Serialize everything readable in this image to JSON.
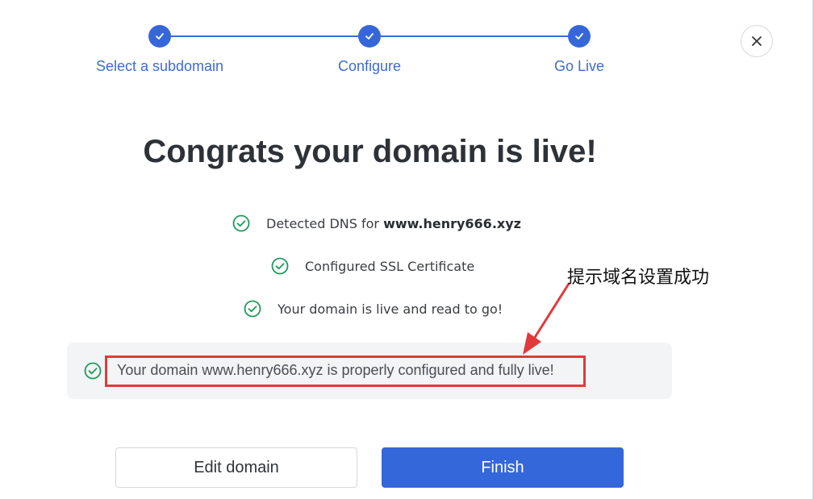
{
  "stepper": {
    "steps": [
      {
        "label": "Select a subdomain",
        "state": "complete"
      },
      {
        "label": "Configure",
        "state": "complete"
      },
      {
        "label": "Go Live",
        "state": "complete"
      }
    ],
    "icon": "check-icon"
  },
  "close": {
    "icon": "close-icon"
  },
  "title": "Congrats your domain is live!",
  "checks": {
    "dns_prefix": "Detected DNS for ",
    "dns_domain": "www.henry666.xyz",
    "ssl": "Configured SSL Certificate",
    "live": "Your domain is live and read to go!"
  },
  "banner": {
    "text": "Your domain www.henry666.xyz is properly configured and fully live!"
  },
  "annotation": {
    "text": "提示域名设置成功",
    "color": "#e23a3a"
  },
  "buttons": {
    "edit": "Edit domain",
    "finish": "Finish"
  },
  "colors": {
    "primary": "#3467da",
    "success": "#1f9a5a",
    "banner_bg": "#f2f4f6"
  }
}
